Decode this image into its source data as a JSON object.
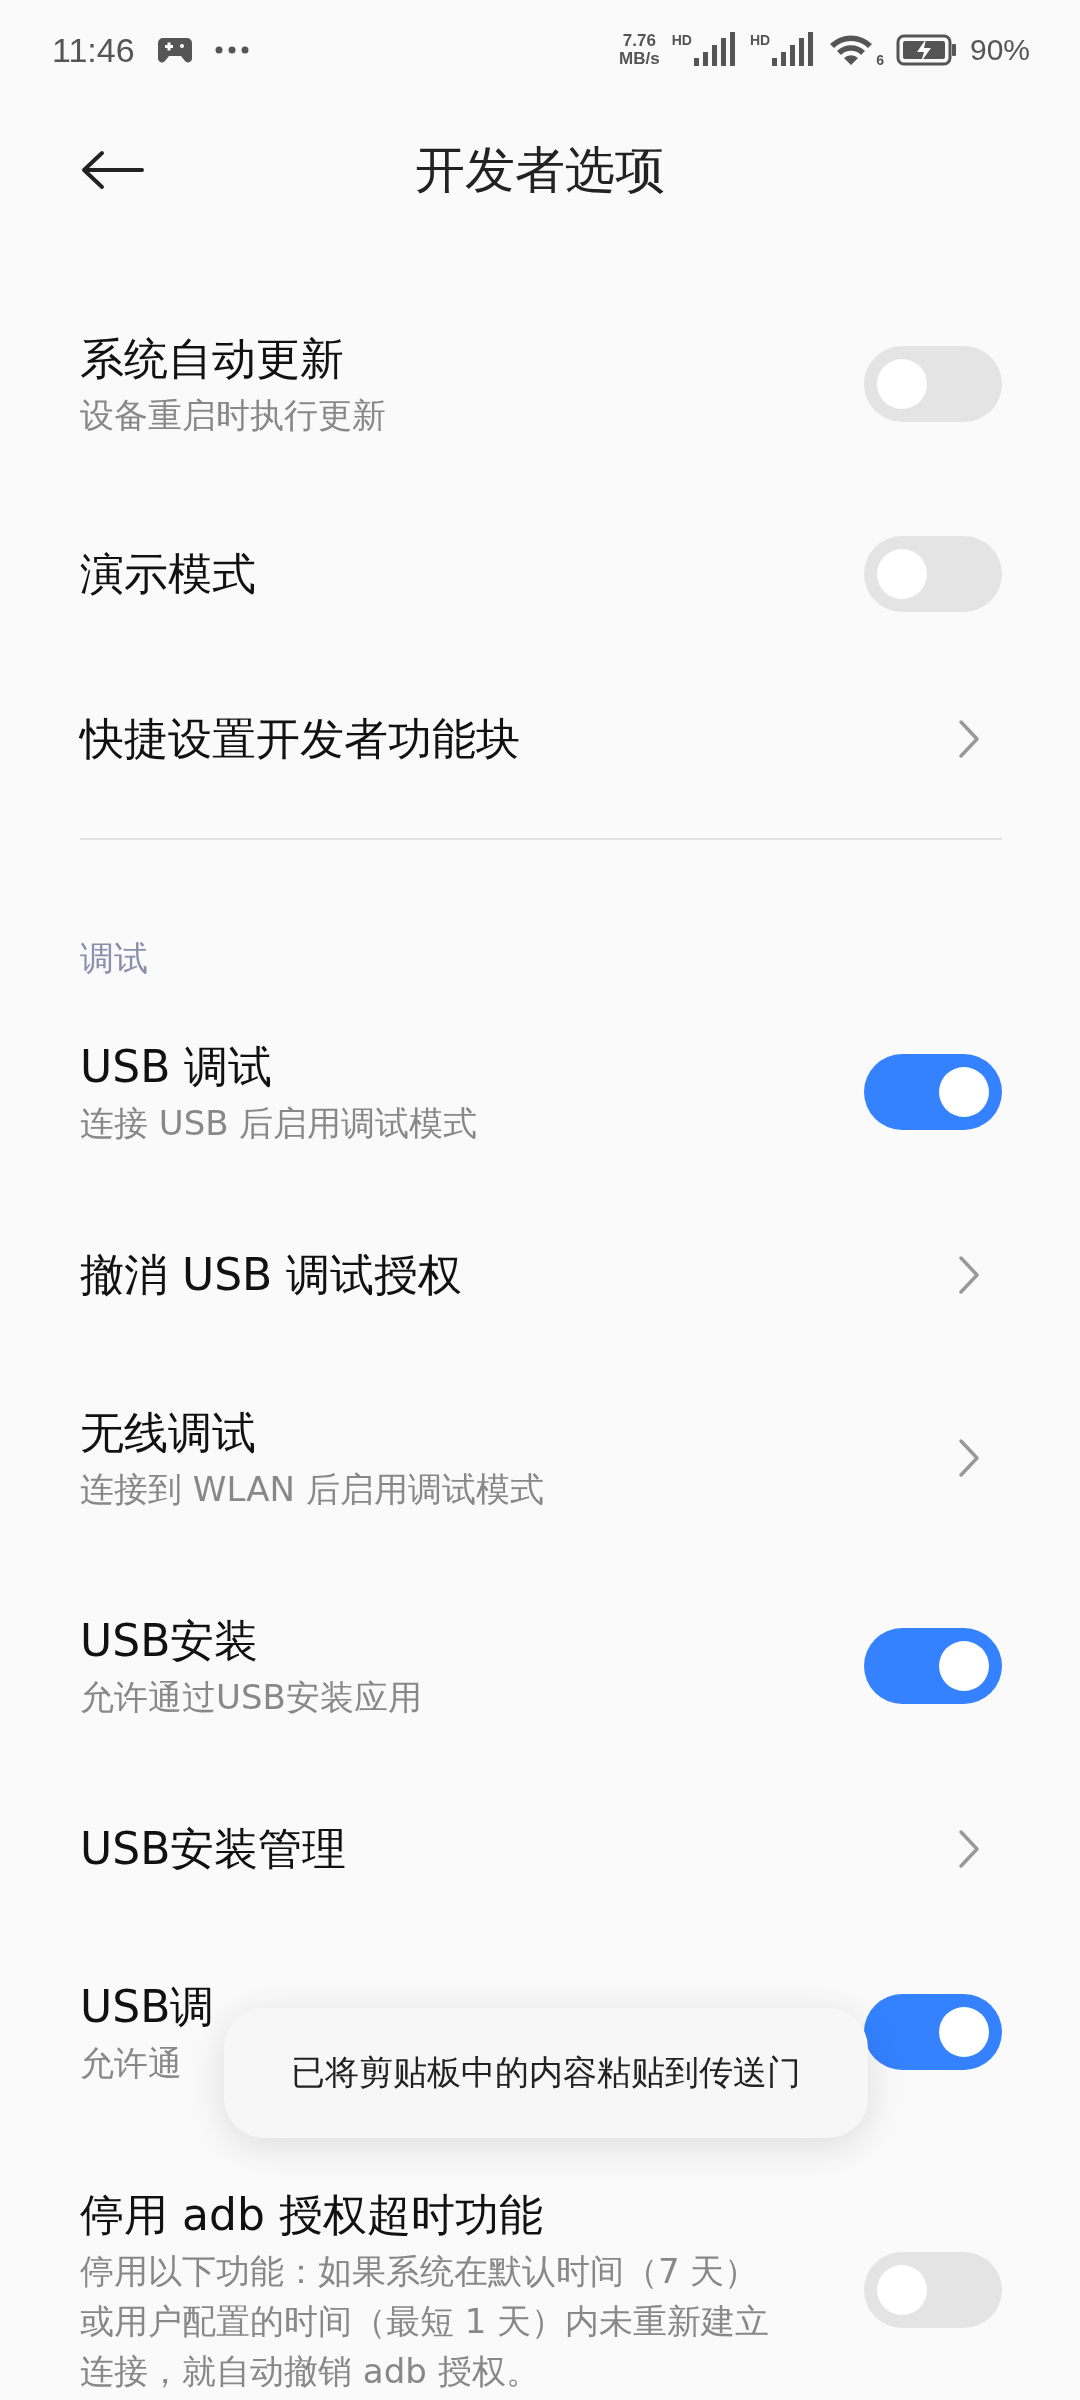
{
  "status_bar": {
    "time": "11:46",
    "net_speed": [
      "7.76",
      "MB/s"
    ],
    "signal_labels": [
      "HD",
      "HD"
    ],
    "wifi_label": "6",
    "battery": "90%"
  },
  "header": {
    "title": "开发者选项"
  },
  "sections": [
    {
      "items": [
        {
          "kind": "toggle",
          "title": "系统自动更新",
          "subtitle": "设备重启时执行更新",
          "on": false
        },
        {
          "kind": "toggle",
          "title": "演示模式",
          "on": false
        },
        {
          "kind": "link",
          "title": "快捷设置开发者功能块"
        }
      ]
    },
    {
      "label": "调试",
      "items": [
        {
          "kind": "toggle",
          "title": "USB 调试",
          "subtitle": "连接 USB 后启用调试模式",
          "on": true
        },
        {
          "kind": "link",
          "title": "撤消 USB 调试授权"
        },
        {
          "kind": "link",
          "title": "无线调试",
          "subtitle": "连接到 WLAN 后启用调试模式"
        },
        {
          "kind": "toggle",
          "title": "USB安装",
          "subtitle": "允许通过USB安装应用",
          "on": true
        },
        {
          "kind": "link",
          "title": "USB安装管理"
        },
        {
          "kind": "toggle",
          "title": "USB调",
          "subtitle": "允许通",
          "on": true
        },
        {
          "kind": "toggle",
          "title": "停用 adb 授权超时功能",
          "subtitle": "停用以下功能：如果系统在默认时间（7 天）或用户配置的时间（最短 1 天）内未重新建立连接，就自动撤销 adb 授权。",
          "on": false
        }
      ]
    }
  ],
  "toast": {
    "text": "已将剪贴板中的内容粘贴到传送门"
  }
}
